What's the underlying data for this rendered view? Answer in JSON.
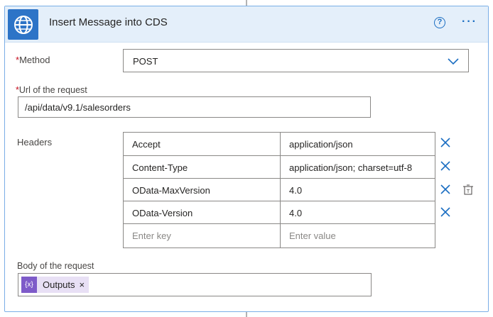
{
  "header": {
    "title": "Insert Message into CDS",
    "help_icon": "?",
    "more_icon": "···"
  },
  "method": {
    "required_mark": "*",
    "label": "Method",
    "value": "POST"
  },
  "url": {
    "required_mark": "*",
    "label": "Url of the request",
    "value": "/api/data/v9.1/salesorders"
  },
  "headers": {
    "label": "Headers",
    "rows": [
      {
        "key": "Accept",
        "value": "application/json"
      },
      {
        "key": "Content-Type",
        "value": "application/json; charset=utf-8"
      },
      {
        "key": "OData-MaxVersion",
        "value": "4.0"
      },
      {
        "key": "OData-Version",
        "value": "4.0"
      }
    ],
    "key_placeholder": "Enter key",
    "value_placeholder": "Enter value"
  },
  "body": {
    "label": "Body of the request",
    "token_label": "Outputs",
    "token_icon": "{x}",
    "token_remove": "×"
  },
  "colors": {
    "accent": "#1b6ec2",
    "header_bg": "#e4effa",
    "app_icon_bg": "#2d74c7",
    "token_bg": "#e8e0f5",
    "token_icon_bg": "#7e5bc9",
    "required": "#c50f1f"
  }
}
